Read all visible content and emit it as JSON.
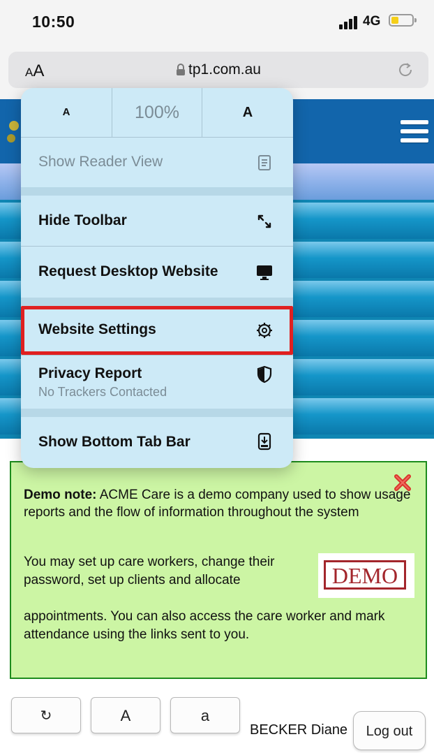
{
  "status_bar": {
    "time": "10:50",
    "network": "4G"
  },
  "url_bar": {
    "text_size_label": "AA",
    "url": "tp1.com.au"
  },
  "menu": {
    "zoom": {
      "decrease_label": "A",
      "level": "100%",
      "increase_label": "A"
    },
    "reader_view": "Show Reader View",
    "hide_toolbar": "Hide Toolbar",
    "request_desktop": "Request Desktop Website",
    "website_settings": "Website Settings",
    "privacy_report": {
      "title": "Privacy Report",
      "subtitle": "No Trackers Contacted"
    },
    "show_bottom_tab_bar": "Show Bottom Tab Bar"
  },
  "demo_note": {
    "heading": "Demo note:",
    "text1": "ACME Care is a demo company used to show usage reports and the flow of information throughout the system",
    "text2": "You may set up care workers, change their password, set up clients and allocate",
    "text3": "appointments. You can also access the care worker and mark attendance using the links sent to you.",
    "badge": "DEMO"
  },
  "bottom_bar": {
    "refresh_label": "↻",
    "font_larger_label": "A",
    "font_smaller_label": "a",
    "user_name": "BECKER Diane",
    "logout_label": "Log out"
  },
  "colors": {
    "header_blue": "#1265ab",
    "note_background": "#ccf5a4",
    "note_border": "#1d8c1d",
    "menu_background": "#cdeaf7",
    "highlight": "#e02020",
    "demo_badge": "#a3262c"
  },
  "icons": {
    "reader": "reader-icon",
    "hide_toolbar": "arrows-diagonal-icon",
    "desktop": "monitor-icon",
    "settings": "gear-icon",
    "privacy": "shield-icon",
    "tab_bar": "phone-download-icon",
    "close": "close-x-icon",
    "lock": "lock-icon",
    "reload": "reload-icon"
  }
}
